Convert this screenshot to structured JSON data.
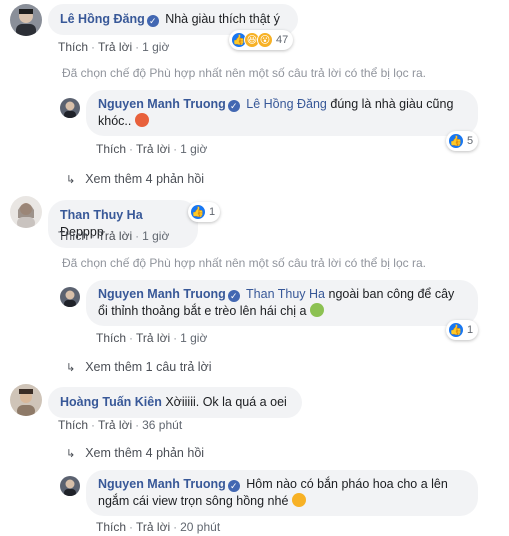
{
  "comments": [
    {
      "name": "Lê Hồng Đăng",
      "text": "Nhà giàu thích thật ý",
      "reaction_count": "47",
      "actions": {
        "like": "Thích",
        "reply": "Trả lời",
        "time": "1 giờ"
      }
    },
    {
      "name": "Than Thuy Ha",
      "text": "Đepppp",
      "reaction_count": "1",
      "actions": {
        "like": "Thích",
        "reply": "Trả lời",
        "time": "1 giờ"
      }
    },
    {
      "name": "Hoàng Tuấn Kiên",
      "text": "Xờiiiii. Ok la quá a oei",
      "actions": {
        "like": "Thích",
        "reply": "Trả lời",
        "time": "36 phút"
      }
    }
  ],
  "replies": [
    {
      "name": "Nguyen Manh Truong",
      "tag": "Lê Hồng Đăng",
      "text_line1": "đúng là nhà giàu cũng",
      "text_line2": "khóc..",
      "reaction_count": "5",
      "actions": {
        "like": "Thích",
        "reply": "Trả lời",
        "time": "1 giờ"
      }
    },
    {
      "name": "Nguyen Manh Truong",
      "tag": "Than Thuy Ha",
      "text_line1": "ngoài ban công để cây",
      "text_line2": "ổi thỉnh thoảng bắt e trèo lên hái chị a",
      "reaction_count": "1",
      "actions": {
        "like": "Thích",
        "reply": "Trả lời",
        "time": "1 giờ"
      }
    },
    {
      "name": "Nguyen Manh Truong",
      "text_line1": "Hôm nào có bắn pháo hoa cho a lên",
      "text_line2": "ngắm cái view trọn sông hồng nhé",
      "actions": {
        "like": "Thích",
        "reply": "Trả lời",
        "time": "20 phút"
      }
    }
  ],
  "filter_note": "Đã chọn chế độ Phù hợp nhất nên một số câu trả lời có thể bị lọc ra.",
  "more_links": [
    "Xem thêm 4 phản hồi",
    "Xem thêm 1 câu trả lời",
    "Xem thêm 4 phản hồi"
  ],
  "colors": {
    "name": "#385898",
    "bubble": "#f2f3f5",
    "like_blue": "#1877f2",
    "muted": "#90949c"
  }
}
